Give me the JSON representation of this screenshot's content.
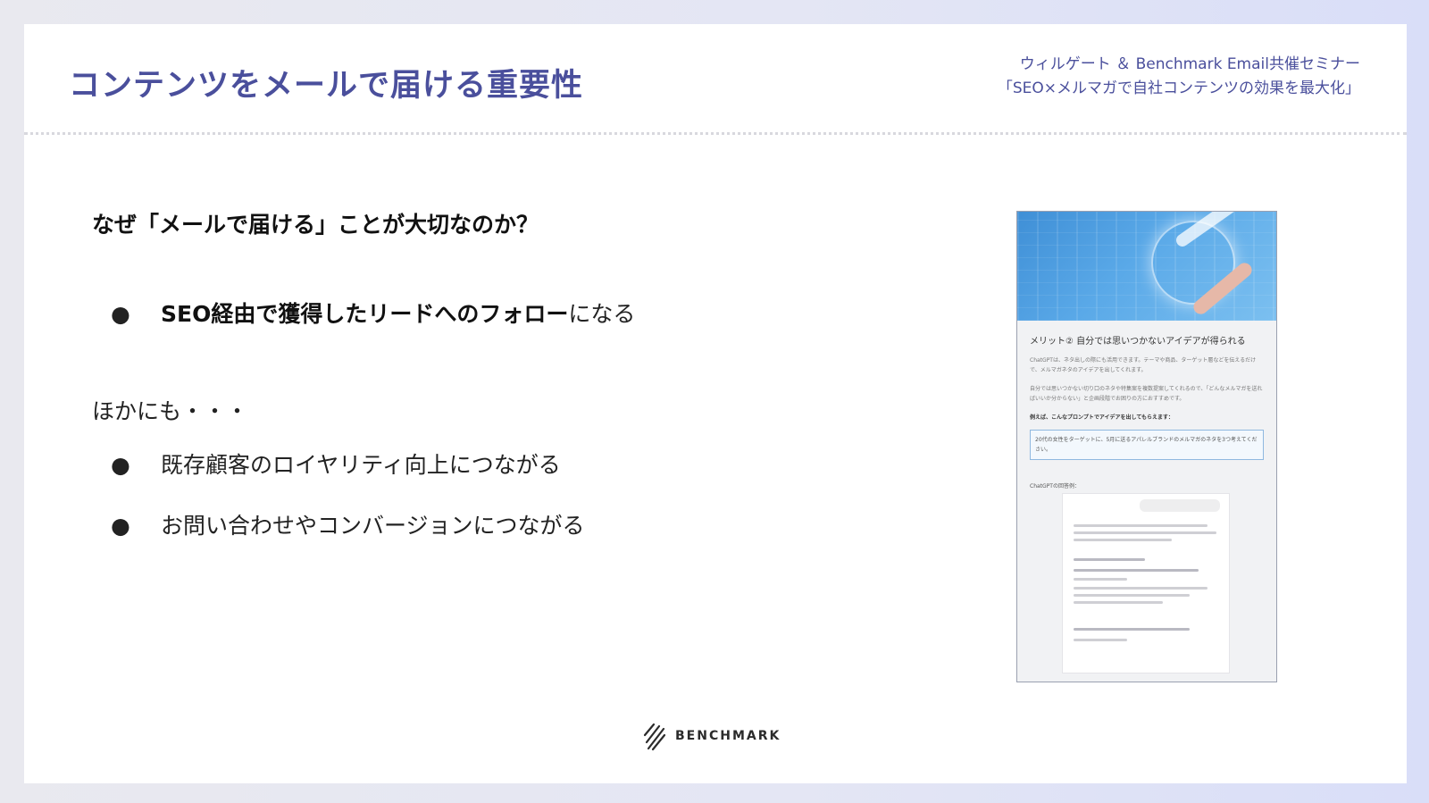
{
  "slide": {
    "title": "コンテンツをメールで届ける重要性",
    "subtitle_line1": "ウィルゲート ＆ Benchmark Email共催セミナー",
    "subtitle_line2": "「SEO×メルマガで自社コンテンツの効果を最大化」",
    "question": "なぜ「メールで届ける」ことが大切なのか？",
    "bullet_main_bold": "SEO経由で獲得したリードへのフォロー",
    "bullet_main_rest": "になる",
    "also_label": "ほかにも・・・",
    "bullet_2": "既存顧客のロイヤリティ向上につながる",
    "bullet_3": "お問い合わせやコンバージョンにつながる",
    "bullet_symbol": "●"
  },
  "preview": {
    "heading": "メリット② 自分では思いつかないアイデアが得られる",
    "para1": "ChatGPTは、ネタ出しの際にも活用できます。テーマや商品、ターゲット層などを伝えるだけで、メルマガネタのアイデアを出してくれます。",
    "para2": "自分では思いつかない切り口のネタや特集案を複数提案してくれるので、「どんなメルマガを送ればいいか分からない」と企画段階でお困りの方におすすめです。",
    "prompt_intro": "例えば、こんなプロンプトでアイデアを出してもらえます：",
    "prompt_box": "20代の女性をターゲットに、5月に送るアパレルブランドのメルマガのネタを3つ考えてください。",
    "answer_label": "ChatGPTの回答例："
  },
  "logo": {
    "text": "BENCHMARK"
  }
}
